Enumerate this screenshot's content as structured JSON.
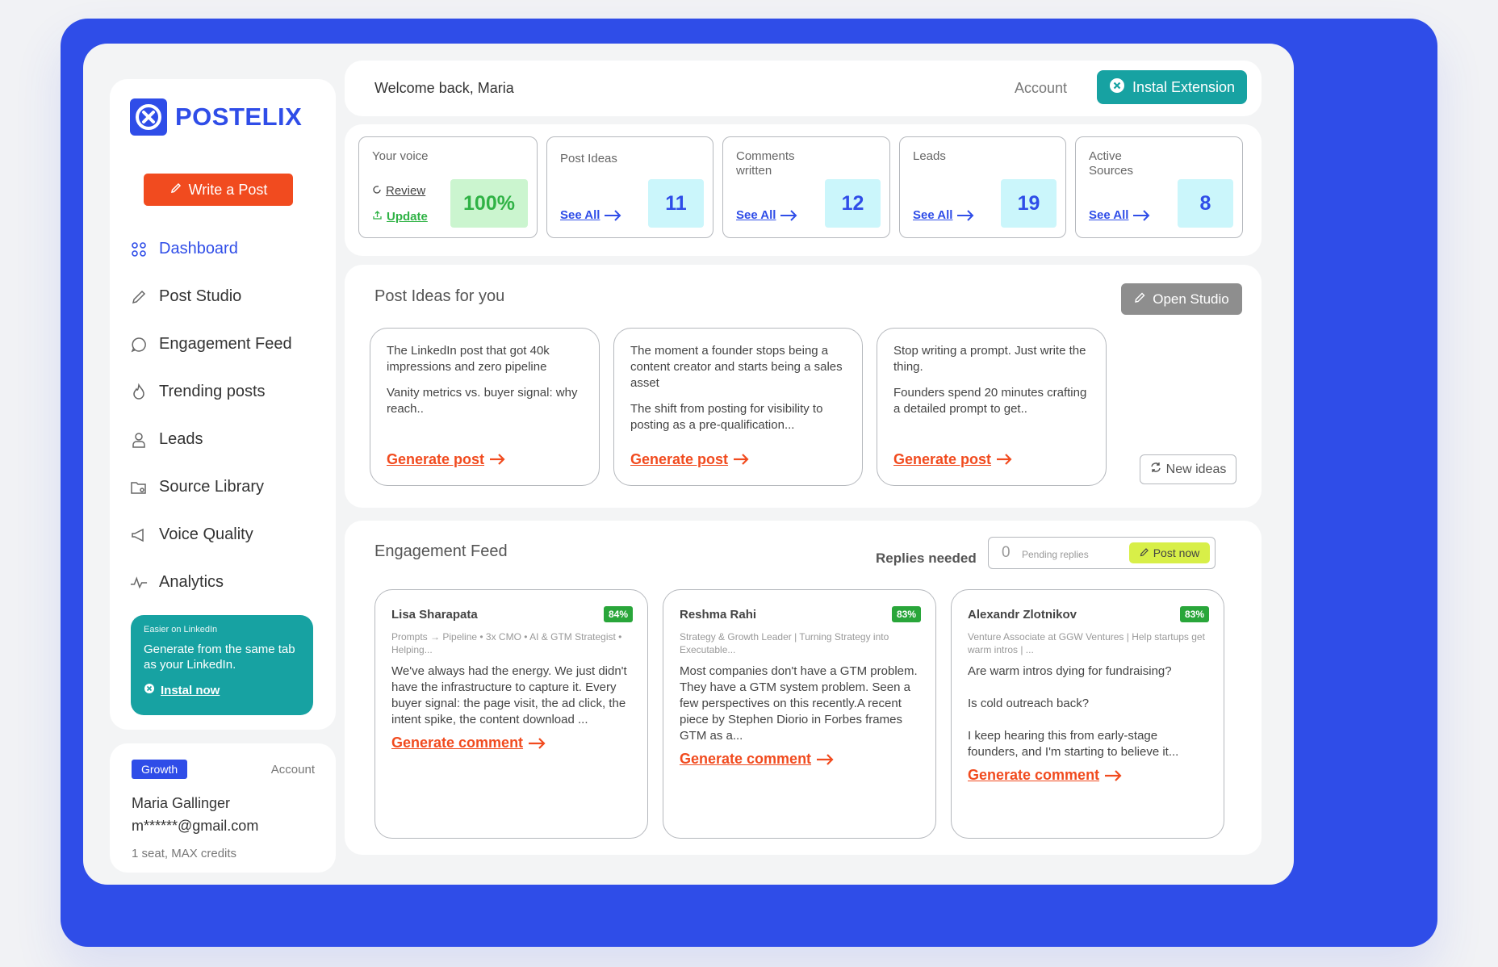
{
  "brand": {
    "name": "POSTELIX",
    "primary": "#2f4de8",
    "accent": "#f14b1f",
    "teal": "#17a2a2"
  },
  "sidebar": {
    "write_label": "Write a Post",
    "items": [
      {
        "label": "Dashboard",
        "icon": "grid-icon",
        "active": true
      },
      {
        "label": "Post Studio",
        "icon": "pen-icon"
      },
      {
        "label": "Engagement Feed",
        "icon": "chat-bubble-icon"
      },
      {
        "label": "Trending posts",
        "icon": "flame-icon"
      },
      {
        "label": "Leads",
        "icon": "user-icon"
      },
      {
        "label": "Source Library",
        "icon": "folder-icon"
      },
      {
        "label": "Voice Quality",
        "icon": "megaphone-icon"
      },
      {
        "label": "Analytics",
        "icon": "pulse-icon"
      }
    ],
    "promo": {
      "kicker": "Easier on LinkedIn",
      "text": "Generate from the same tab as your LinkedIn.",
      "cta": "Instal now"
    }
  },
  "account": {
    "plan": "Growth",
    "link": "Account",
    "name": "Maria Gallinger",
    "email": "m******@gmail.com",
    "seat": "1 seat, MAX credits"
  },
  "header": {
    "welcome": "Welcome back, Maria",
    "account": "Account",
    "install": "Instal Extension"
  },
  "stats": {
    "voice": {
      "label": "Your voice",
      "review": "Review",
      "update": "Update",
      "value": "100%"
    },
    "cards": [
      {
        "label": "Post Ideas",
        "value": "11",
        "link": "See All"
      },
      {
        "label": "Comments\nwritten",
        "value": "12",
        "link": "See All"
      },
      {
        "label": "Leads",
        "value": "19",
        "link": "See All"
      },
      {
        "label": "Active\nSources",
        "value": "8",
        "link": "See All"
      }
    ]
  },
  "ideas": {
    "title": "Post Ideas for you",
    "open_studio": "Open Studio",
    "new_ideas": "New ideas",
    "cards": [
      {
        "headline": "The LinkedIn post that got 40k impressions and zero pipeline",
        "body": "Vanity metrics vs. buyer signal: why reach..",
        "cta": "Generate post"
      },
      {
        "headline": "The moment a founder stops being a content creator and starts being a sales asset",
        "body": "The shift from posting for visibility to posting as a pre-qualification...",
        "cta": "Generate post"
      },
      {
        "headline": "Stop writing a prompt. Just write the thing.",
        "body": "Founders spend 20 minutes crafting a detailed prompt to get..",
        "cta": "Generate post"
      }
    ]
  },
  "engagement": {
    "title": "Engagement Feed",
    "replies_label": "Replies needed",
    "pending_count": "0",
    "pending_label": "Pending replies",
    "post_now": "Post now",
    "cards": [
      {
        "name": "Lisa Sharapata",
        "score": "84%",
        "role": "Prompts → Pipeline • 3x CMO • AI & GTM Strategist • Helping...",
        "body": "We've always had the energy. We just didn't have the infrastructure to capture it. Every buyer signal: the page visit, the ad click, the intent spike, the content download ...",
        "cta": "Generate comment"
      },
      {
        "name": "Reshma Rahi",
        "score": "83%",
        "role": "Strategy & Growth Leader | Turning Strategy into Executable...",
        "body": "Most companies don't have a GTM problem.\nThey have a GTM system problem. Seen a few perspectives on this recently.A recent piece by Stephen Diorio in Forbes frames GTM as a...",
        "cta": "Generate comment"
      },
      {
        "name": "Alexandr Zlotnikov",
        "score": "83%",
        "role": "Venture Associate at GGW Ventures | Help startups get warm intros | ...",
        "body": "Are warm intros dying for fundraising?\n\nIs cold outreach back?\n\nI keep hearing this from early-stage founders, and I'm starting to believe it...",
        "cta": "Generate comment"
      }
    ]
  }
}
